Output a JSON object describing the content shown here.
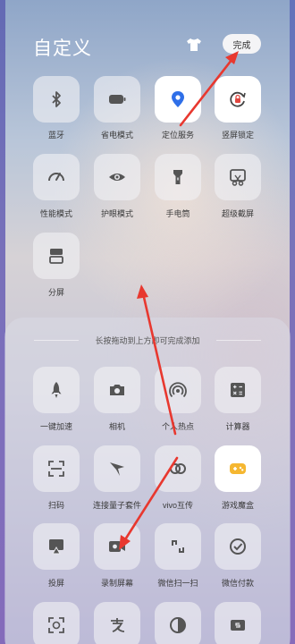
{
  "header": {
    "title": "自定义",
    "done_label": "完成"
  },
  "active_tiles": [
    {
      "label": "蓝牙",
      "icon": "bluetooth-icon"
    },
    {
      "label": "省电模式",
      "icon": "battery-icon"
    },
    {
      "label": "定位服务",
      "icon": "location-icon"
    },
    {
      "label": "竖屏锁定",
      "icon": "rotation-lock-icon"
    },
    {
      "label": "性能模式",
      "icon": "speedometer-icon"
    },
    {
      "label": "护眼模式",
      "icon": "eye-icon"
    },
    {
      "label": "手电筒",
      "icon": "flashlight-icon"
    },
    {
      "label": "超级截屏",
      "icon": "screenshot-icon"
    },
    {
      "label": "分屏",
      "icon": "split-screen-icon"
    }
  ],
  "panel": {
    "hint": "长按拖动到上方即可完成添加"
  },
  "available_tiles": [
    {
      "label": "一键加速",
      "icon": "rocket-icon"
    },
    {
      "label": "相机",
      "icon": "camera-icon"
    },
    {
      "label": "个人热点",
      "icon": "hotspot-icon"
    },
    {
      "label": "计算器",
      "icon": "calculator-icon"
    },
    {
      "label": "扫码",
      "icon": "scan-icon"
    },
    {
      "label": "连接量子套件",
      "icon": "quantum-icon"
    },
    {
      "label": "vivo互传",
      "icon": "share-icon"
    },
    {
      "label": "游戏魔盒",
      "icon": "game-icon"
    },
    {
      "label": "投屏",
      "icon": "cast-icon"
    },
    {
      "label": "录制屏幕",
      "icon": "record-icon"
    },
    {
      "label": "微信扫一扫",
      "icon": "wechat-scan-icon"
    },
    {
      "label": "微信付款",
      "icon": "wechat-pay-icon"
    },
    {
      "label": "",
      "icon": "face-scan-icon"
    },
    {
      "label": "",
      "icon": "alipay-icon"
    },
    {
      "label": "",
      "icon": "contrast-icon"
    },
    {
      "label": "",
      "icon": "wallet-icon"
    }
  ],
  "colors": {
    "accent": "#2f6fe8",
    "arrow": "#e8382f",
    "game": "#f5b731"
  }
}
